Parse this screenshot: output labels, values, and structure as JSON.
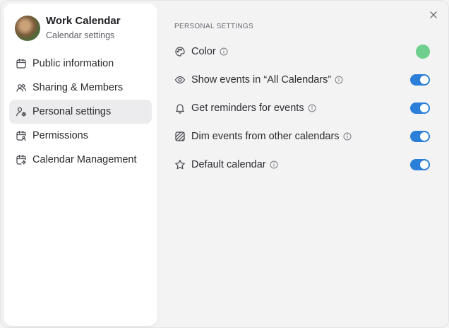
{
  "calendar": {
    "title": "Work Calendar",
    "subtitle": "Calendar settings"
  },
  "nav": {
    "items": [
      {
        "label": "Public information",
        "icon": "calendar-icon"
      },
      {
        "label": "Sharing & Members",
        "icon": "users-icon"
      },
      {
        "label": "Personal settings",
        "icon": "user-gear-icon",
        "active": true
      },
      {
        "label": "Permissions",
        "icon": "calendar-user-icon"
      },
      {
        "label": "Calendar Management",
        "icon": "calendar-gear-icon"
      }
    ]
  },
  "settings": {
    "section_title": "PERSONAL SETTINGS",
    "rows": [
      {
        "label": "Color",
        "icon": "palette-icon",
        "control": "color",
        "value": "#6fcf8e"
      },
      {
        "label": "Show events in “All Calendars”",
        "icon": "eye-icon",
        "control": "toggle",
        "value": true
      },
      {
        "label": "Get reminders for events",
        "icon": "bell-icon",
        "control": "toggle",
        "value": true
      },
      {
        "label": "Dim events from other calendars",
        "icon": "dim-pattern-icon",
        "control": "toggle",
        "value": true
      },
      {
        "label": "Default calendar",
        "icon": "star-icon",
        "control": "toggle",
        "value": true
      }
    ]
  },
  "colors": {
    "accent_toggle": "#2b7fd9",
    "calendar_color": "#6fcf8e",
    "active_nav_bg": "#ececee"
  }
}
